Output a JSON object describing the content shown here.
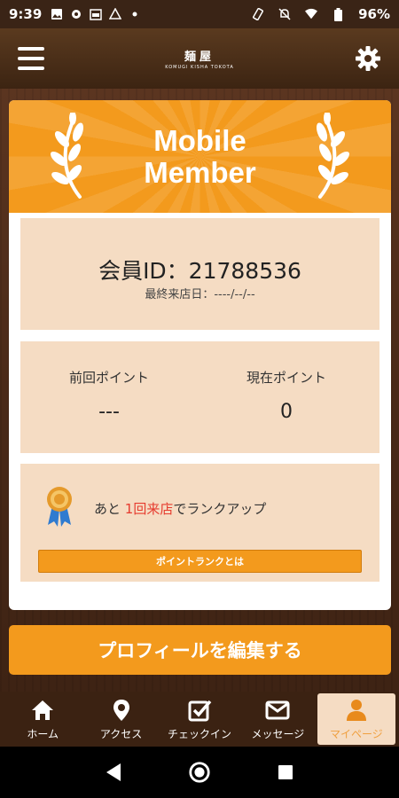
{
  "status": {
    "time": "9:39",
    "battery": "96%",
    "icons_left": [
      "image-icon",
      "settings-icon",
      "store-icon",
      "drive-icon",
      "dot-icon"
    ],
    "icons_right": [
      "rotate-icon",
      "mute-icon",
      "wifi-icon",
      "battery-icon"
    ]
  },
  "header": {
    "logo_main": "麺屋",
    "logo_sub": "KOMUGI KISHA TOKOTA",
    "menu_icon": "hamburger-icon",
    "settings_icon": "gear-icon"
  },
  "card": {
    "title_line1": "Mobile",
    "title_line2": "Member",
    "member_id": "会員ID：21788536",
    "last_visit": "最終来店日：----/--/--",
    "prev_points_label": "前回ポイント",
    "prev_points_value": "---",
    "current_points_label": "現在ポイント",
    "current_points_value": "0",
    "rank_prefix": "あと",
    "rank_highlight": "1回来店",
    "rank_suffix": "でランクアップ",
    "rank_button": "ポイントランクとは"
  },
  "edit_profile": "プロフィールを編集する",
  "tabs": [
    {
      "label": "ホーム",
      "icon": "home-icon",
      "active": false
    },
    {
      "label": "アクセス",
      "icon": "map-pin-icon",
      "active": false
    },
    {
      "label": "チェックイン",
      "icon": "checkbox-icon",
      "active": false
    },
    {
      "label": "メッセージ",
      "icon": "mail-icon",
      "active": false
    },
    {
      "label": "マイページ",
      "icon": "user-icon",
      "active": true
    }
  ],
  "colors": {
    "accent": "#f39a1d",
    "panel": "#f5dcc3",
    "highlight": "#e63b2e",
    "wood": "#4a2a18"
  }
}
